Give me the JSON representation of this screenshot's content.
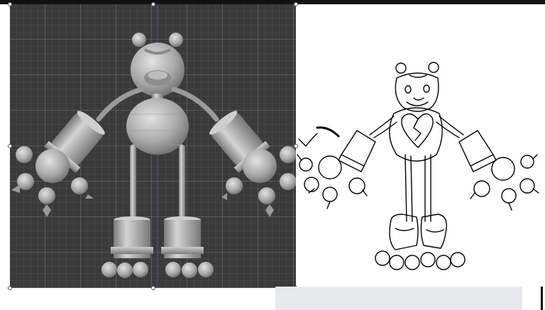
{
  "window": {
    "title": ""
  },
  "viewport": {
    "object_name": "",
    "grid_color": "#3a3a3a",
    "axis_color": "#4a5d8f",
    "model_color": "#b8b8b8",
    "selection_handle_color": "#ffffff"
  },
  "reference_image": {
    "caption": "",
    "line_color": "#000000",
    "background": "#ffffff"
  },
  "icons": [
    "selection-handle-icon"
  ],
  "bottom_panel": {
    "color": "#e6eaee"
  }
}
